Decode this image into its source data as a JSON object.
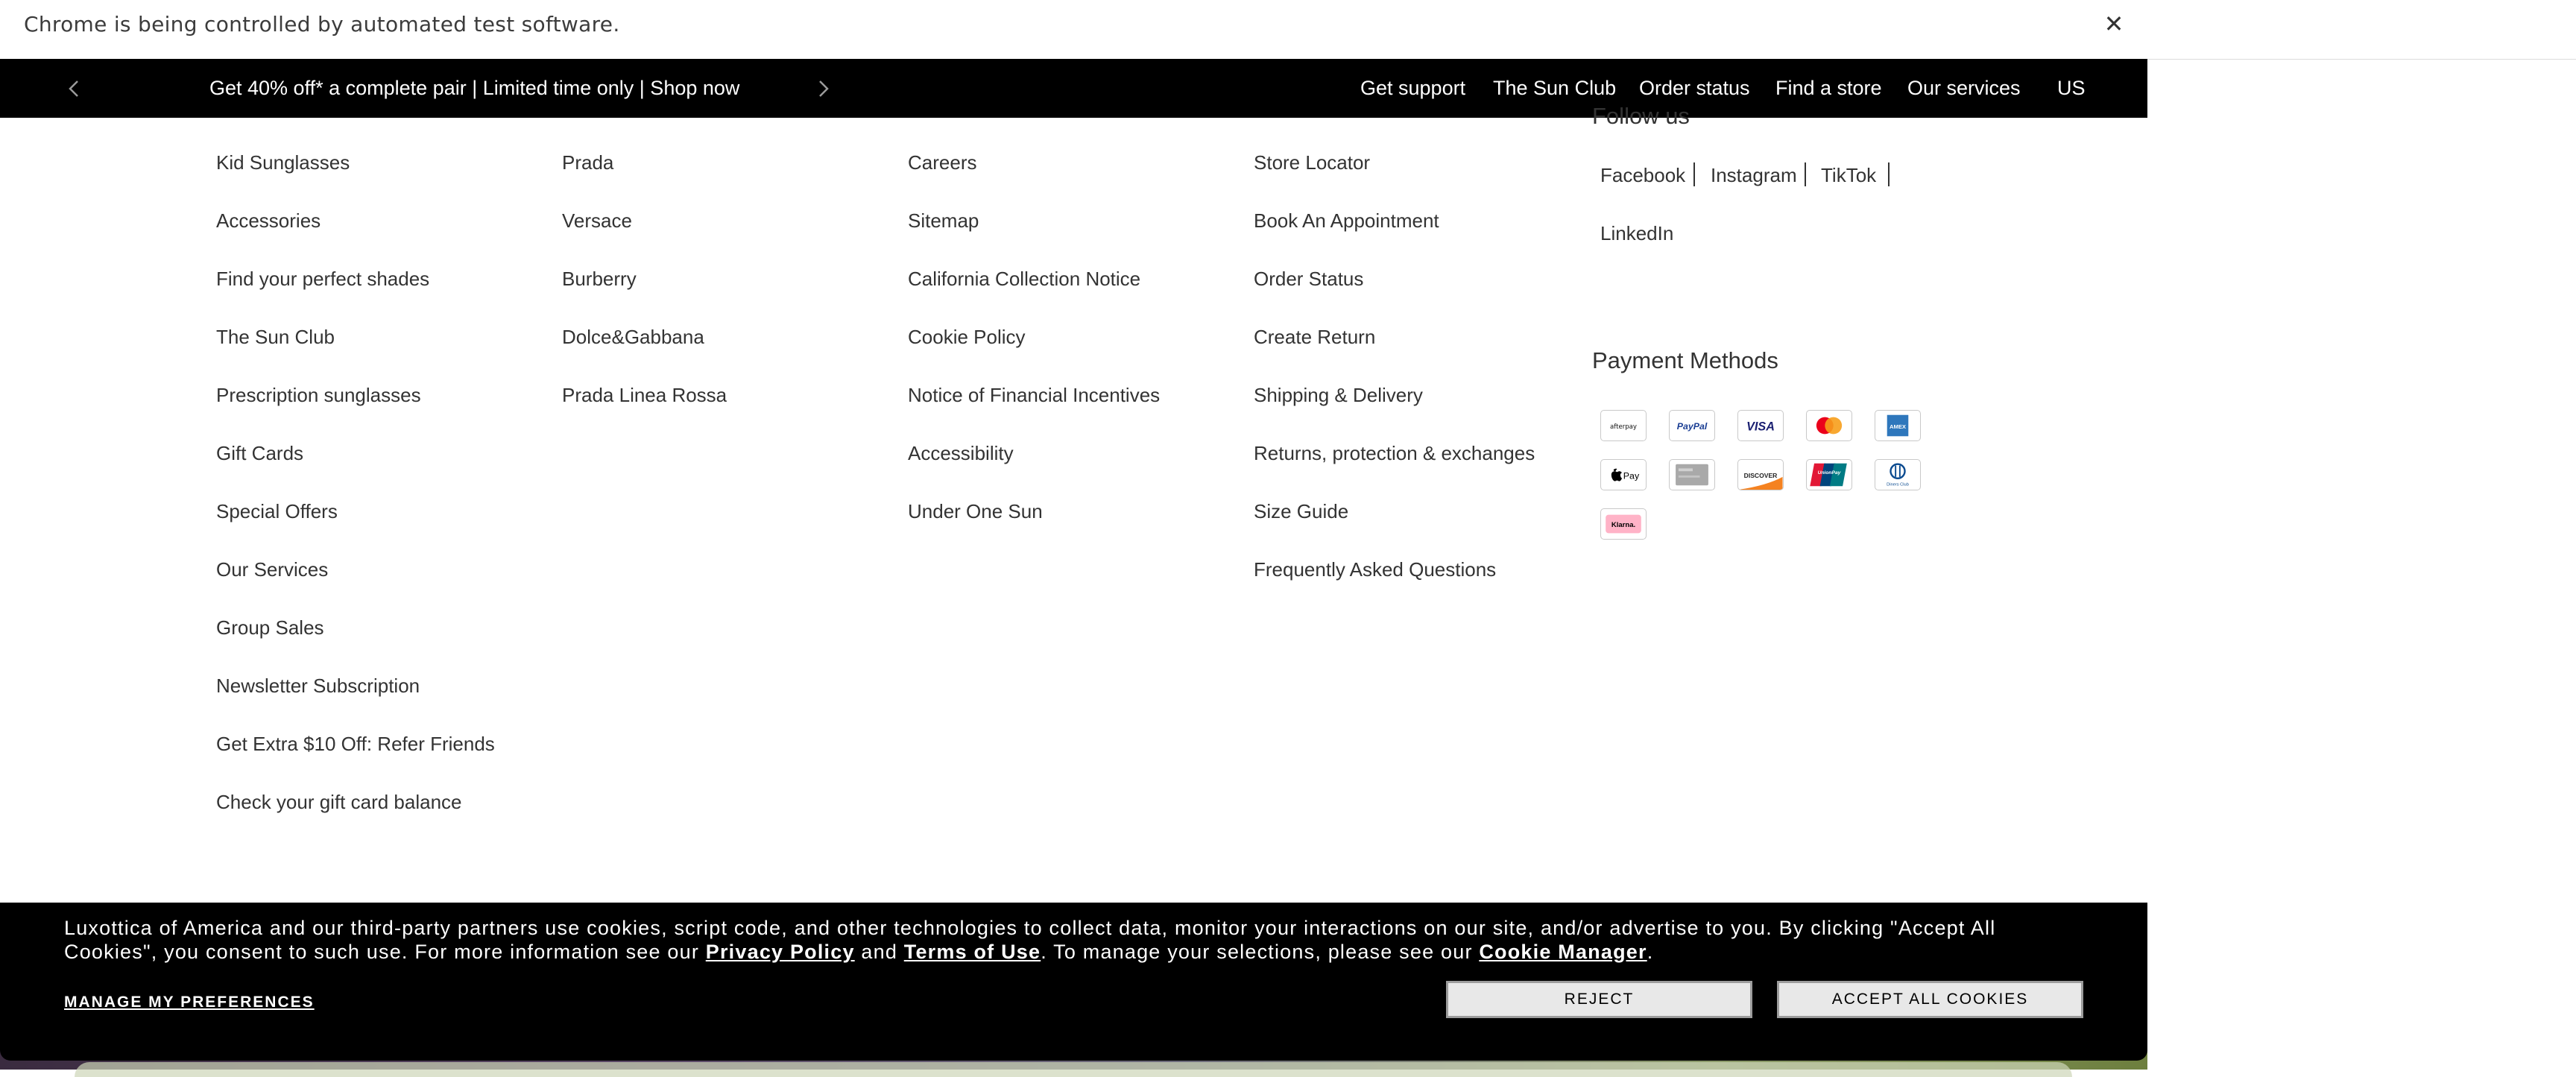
{
  "browser": {
    "infobar_text": "Chrome is being controlled by automated test software.",
    "close_glyph": "✕"
  },
  "topnav": {
    "promo_text": "Get 40% off* a complete pair | Limited time only | Shop now",
    "links": [
      "Get support",
      "The Sun Club",
      "Order status",
      "Find a store",
      "Our services",
      "US"
    ]
  },
  "footer": {
    "col1": [
      "Kid Sunglasses",
      "Accessories",
      "Find your perfect shades",
      "The Sun Club",
      "Prescription sunglasses",
      "Gift Cards",
      "Special Offers",
      "Our Services",
      "Group Sales",
      "Newsletter Subscription",
      "Get Extra $10 Off: Refer Friends",
      "Check your gift card balance"
    ],
    "col2": [
      "Prada",
      "Versace",
      "Burberry",
      "Dolce&Gabbana",
      "Prada Linea Rossa"
    ],
    "col3": [
      "Careers",
      "Sitemap",
      "California Collection Notice",
      "Cookie Policy",
      "Notice of Financial Incentives",
      "Accessibility",
      "Under One Sun"
    ],
    "col4": [
      "Store Locator",
      "Book An Appointment",
      "Order Status",
      "Create Return",
      "Shipping & Delivery",
      "Returns, protection & exchanges",
      "Size Guide",
      "Frequently Asked Questions"
    ],
    "follow_us_title": "Follow us",
    "social": [
      "Facebook",
      "Instagram",
      "TikTok",
      "LinkedIn"
    ],
    "payment_title": "Payment Methods",
    "payment_methods": [
      {
        "name": "afterpay",
        "label": "afterpay"
      },
      {
        "name": "paypal",
        "label": "PayPal"
      },
      {
        "name": "visa",
        "label": "VISA"
      },
      {
        "name": "mastercard",
        "label": ""
      },
      {
        "name": "amex",
        "label": "AMEX"
      },
      {
        "name": "apple-pay",
        "label": "Pay"
      },
      {
        "name": "gift-card",
        "label": ""
      },
      {
        "name": "discover",
        "label": "DISCOVER"
      },
      {
        "name": "unionpay",
        "label": "UnionPay"
      },
      {
        "name": "diners-club",
        "label": "Diners Club"
      },
      {
        "name": "klarna",
        "label": "Klarna."
      }
    ]
  },
  "cookie_banner": {
    "text_part1": "Luxottica of America and our third-party partners use cookies, script code, and other technologies to collect data, monitor your interactions on our site, and/or advertise to you. By clicking \"Accept All Cookies\", you consent to such use. For more information see our ",
    "privacy_link": "Privacy Policy",
    "text_and": " and ",
    "terms_link": "Terms of Use",
    "text_part2": ". To manage your selections, please see our ",
    "cookie_manager_link": "Cookie Manager",
    "text_end": ".",
    "manage_label": "MANAGE MY PREFERENCES",
    "reject_label": "REJECT",
    "accept_label": "ACCEPT ALL COOKIES"
  }
}
